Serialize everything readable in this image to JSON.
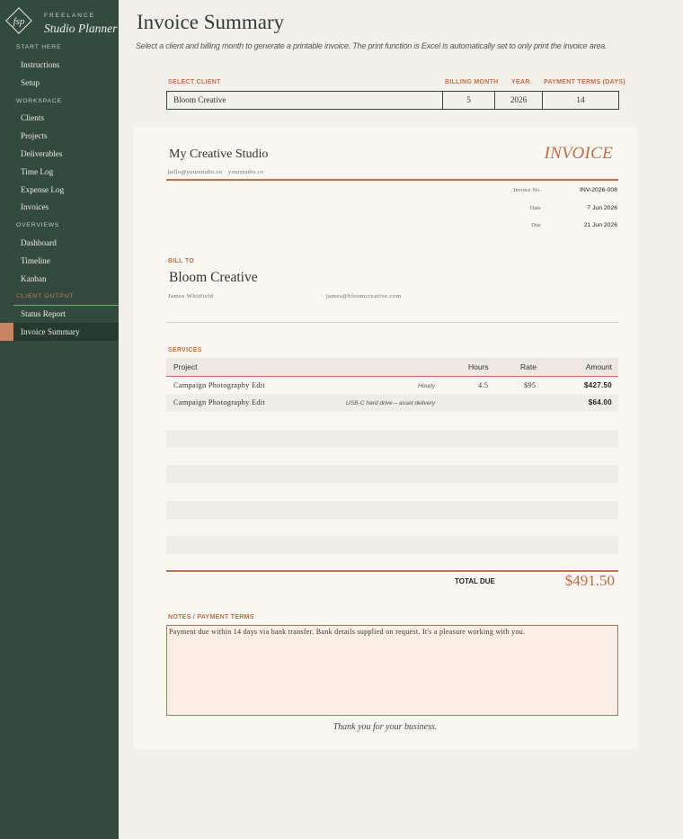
{
  "brand": {
    "logo_text": "fsp",
    "small": "FREELANCE",
    "title": "Studio Planner"
  },
  "nav": {
    "sections": [
      {
        "label": "START HERE",
        "items": [
          "Instructions",
          "Setup"
        ]
      },
      {
        "label": "WORKSPACE",
        "items": [
          "Clients",
          "Projects",
          "Deliverables",
          "Time Log",
          "Expense Log",
          "Invoices"
        ]
      },
      {
        "label": "OVERVIEWS",
        "items": [
          "Dashboard",
          "Timeline",
          "Kanban"
        ]
      },
      {
        "label": "CLIENT OUTPUT",
        "items": [
          "Status Report",
          "Invoice Summary"
        ]
      }
    ],
    "active": "Invoice Summary"
  },
  "page": {
    "title": "Invoice Summary",
    "subtitle": "Select a client and billing month to generate a printable invoice. The print function is Excel is automatically set to only print the invoice area."
  },
  "selectors": {
    "client_label": "SELECT CLIENT",
    "client_value": "Bloom Creative",
    "month_label": "BILLING MONTH",
    "month_value": "5",
    "year_label": "YEAR",
    "year_value": "2026",
    "terms_label": "PAYMENT TERMS (DAYS)",
    "terms_value": "14"
  },
  "invoice": {
    "studio_name": "My Creative Studio",
    "heading": "INVOICE",
    "studio_contact": "hello@yourstudio.co  ·  yourstudio.co",
    "meta": [
      {
        "label": "Invoice No.",
        "value": "INV-2026-006"
      },
      {
        "label": "Date",
        "value": "7 Jun 2026"
      },
      {
        "label": "Due",
        "value": "21 Jun 2026"
      }
    ],
    "bill_to_label": "BILL TO",
    "bill_to_name": "Bloom Creative",
    "contact_name": "James Whitfield",
    "contact_email": "· james@bloomcreative.com",
    "services_label": "SERVICES",
    "columns": {
      "project": "Project",
      "hours": "Hours",
      "rate": "Rate",
      "amount": "Amount"
    },
    "rows": [
      {
        "project": "Campaign Photography Edit",
        "note": "Hourly",
        "hours": "4.5",
        "rate": "$95",
        "amount": "$427.50"
      },
      {
        "project": "Campaign Photography Edit",
        "note": "USB-C hard drive – asset delivery",
        "hours": "",
        "rate": "",
        "amount": "$64.00"
      }
    ],
    "total_label": "TOTAL DUE",
    "total_value": "$491.50",
    "notes_label": "NOTES / PAYMENT TERMS",
    "notes_text": "Payment due within 14 days via bank transfer. Bank details supplied on request. It's a pleasure working with you.",
    "thanks": "Thank you for your business."
  }
}
